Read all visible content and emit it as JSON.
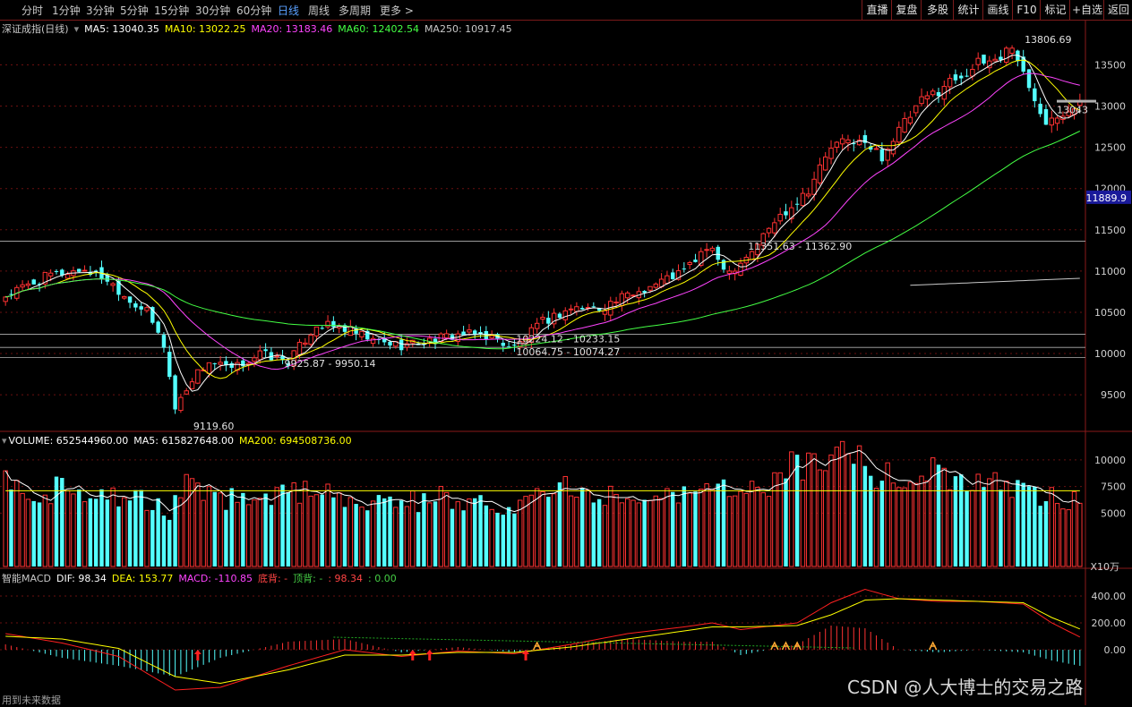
{
  "toolbar": {
    "periods": [
      "分时",
      "1分钟",
      "3分钟",
      "5分钟",
      "15分钟",
      "30分钟",
      "60分钟",
      "日线",
      "周线",
      "多周期",
      "更多 >"
    ],
    "active_period": "日线",
    "right_buttons": [
      "直播",
      "复盘",
      "多股",
      "统计",
      "画线",
      "F10",
      "标记",
      "+自选",
      "返回"
    ]
  },
  "price_panel": {
    "title": "深证成指(日线)",
    "ma_labels": [
      {
        "text": "MA5: 13040.35",
        "color": "#ffffff"
      },
      {
        "text": "MA10: 13022.25",
        "color": "#ffff00"
      },
      {
        "text": "MA20: 13183.46",
        "color": "#ff44ff"
      },
      {
        "text": "MA60: 12402.54",
        "color": "#44ff44"
      },
      {
        "text": "MA250: 10917.45",
        "color": "#c8c8c8"
      }
    ],
    "current_price_label": "11889.9",
    "right_edge_label": "13043",
    "annotations": [
      "13806.69",
      "9119.60",
      "9925.87 - 9950.14",
      "10224.12 - 10233.15",
      "10064.75 - 10074.27",
      "11351.63 - 11362.90"
    ]
  },
  "volume_panel": {
    "legend": [
      {
        "text": "VOLUME: 652544960.00",
        "color": "#ffffff"
      },
      {
        "text": "MA5: 615827648.00",
        "color": "#ffffff"
      },
      {
        "text": "MA200: 694508736.00",
        "color": "#ffff00"
      }
    ],
    "unit": "X10万"
  },
  "macd_panel": {
    "legend": [
      {
        "text": "智能MACD",
        "color": "#c8c8c8"
      },
      {
        "text": "DIF: 98.34",
        "color": "#ffffff"
      },
      {
        "text": "DEA: 153.77",
        "color": "#ffff00"
      },
      {
        "text": "MACD: -110.85",
        "color": "#ff44ff"
      },
      {
        "text": "底背: -",
        "color": "#ff4444"
      },
      {
        "text": "顶背: -",
        "color": "#44cc44"
      },
      {
        "text": ": 98.34",
        "color": "#ff4444"
      },
      {
        "text": ": 0.00",
        "color": "#44cc44"
      }
    ]
  },
  "bottom_note": "用到未来数据",
  "watermark": "CSDN @人大博士的交易之路",
  "chart_data": [
    {
      "type": "candlestick",
      "panel": "price",
      "ylim": [
        9100,
        13950
      ],
      "y_ticks": [
        9500,
        10000,
        10500,
        11000,
        11500,
        12000,
        12500,
        13000,
        13500
      ],
      "grid": "horizontal dashed",
      "horizontal_levels": [
        11362.9,
        10233.15,
        10074.27,
        9950.14
      ],
      "anchors_close": [
        [
          0,
          10700
        ],
        [
          8,
          10950
        ],
        [
          14,
          11020
        ],
        [
          18,
          10900
        ],
        [
          22,
          10650
        ],
        [
          25,
          10500
        ],
        [
          28,
          10100
        ],
        [
          30,
          9330
        ],
        [
          33,
          9700
        ],
        [
          36,
          9900
        ],
        [
          40,
          9800
        ],
        [
          45,
          10000
        ],
        [
          50,
          9900
        ],
        [
          55,
          10350
        ],
        [
          60,
          10300
        ],
        [
          65,
          10150
        ],
        [
          70,
          10100
        ],
        [
          75,
          10150
        ],
        [
          80,
          10230
        ],
        [
          85,
          10220
        ],
        [
          90,
          10070
        ],
        [
          95,
          10380
        ],
        [
          100,
          10550
        ],
        [
          105,
          10550
        ],
        [
          110,
          10700
        ],
        [
          115,
          10850
        ],
        [
          120,
          11000
        ],
        [
          124,
          11280
        ],
        [
          128,
          11000
        ],
        [
          132,
          11250
        ],
        [
          136,
          11600
        ],
        [
          142,
          12000
        ],
        [
          146,
          12500
        ],
        [
          150,
          12600
        ],
        [
          155,
          12400
        ],
        [
          158,
          12700
        ],
        [
          162,
          13050
        ],
        [
          167,
          13300
        ],
        [
          172,
          13500
        ],
        [
          176,
          13600
        ],
        [
          178,
          13750
        ],
        [
          181,
          13200
        ],
        [
          184,
          12850
        ],
        [
          187,
          12950
        ],
        [
          190,
          13040
        ]
      ],
      "ma_series": [
        "MA5",
        "MA10",
        "MA20",
        "MA60",
        "MA250"
      ]
    },
    {
      "type": "bar",
      "panel": "volume",
      "unit": "X10万",
      "ylim": [
        0,
        11500
      ],
      "y_ticks": [
        5000,
        7500,
        10000
      ],
      "ma200_level": 7100,
      "anchors": [
        [
          0,
          8200
        ],
        [
          6,
          7000
        ],
        [
          12,
          7400
        ],
        [
          18,
          6800
        ],
        [
          24,
          6100
        ],
        [
          29,
          5000
        ],
        [
          32,
          8600
        ],
        [
          36,
          6400
        ],
        [
          42,
          6500
        ],
        [
          50,
          6800
        ],
        [
          56,
          7000
        ],
        [
          62,
          6200
        ],
        [
          70,
          6100
        ],
        [
          80,
          6500
        ],
        [
          90,
          5600
        ],
        [
          95,
          7100
        ],
        [
          100,
          7200
        ],
        [
          110,
          6600
        ],
        [
          115,
          7400
        ],
        [
          120,
          7000
        ],
        [
          126,
          6900
        ],
        [
          132,
          7100
        ],
        [
          136,
          8000
        ],
        [
          140,
          9700
        ],
        [
          144,
          10200
        ],
        [
          148,
          11200
        ],
        [
          152,
          9500
        ],
        [
          156,
          8300
        ],
        [
          160,
          7800
        ],
        [
          165,
          9000
        ],
        [
          170,
          8200
        ],
        [
          176,
          7400
        ],
        [
          180,
          7400
        ],
        [
          186,
          6300
        ],
        [
          190,
          6500
        ]
      ]
    },
    {
      "type": "line",
      "panel": "macd",
      "series": [
        "DIF",
        "DEA",
        "MACD"
      ],
      "ylim": [
        -380,
        520
      ],
      "y_ticks": [
        0,
        200,
        400
      ],
      "dif_anchors": [
        [
          0,
          120
        ],
        [
          10,
          50
        ],
        [
          20,
          -50
        ],
        [
          30,
          -300
        ],
        [
          38,
          -280
        ],
        [
          50,
          -120
        ],
        [
          60,
          0
        ],
        [
          70,
          -50
        ],
        [
          80,
          -10
        ],
        [
          90,
          -30
        ],
        [
          100,
          40
        ],
        [
          110,
          120
        ],
        [
          120,
          170
        ],
        [
          125,
          200
        ],
        [
          130,
          150
        ],
        [
          140,
          200
        ],
        [
          146,
          350
        ],
        [
          152,
          450
        ],
        [
          158,
          380
        ],
        [
          165,
          360
        ],
        [
          172,
          360
        ],
        [
          180,
          340
        ],
        [
          185,
          200
        ],
        [
          190,
          95
        ]
      ],
      "dea_anchors": [
        [
          0,
          100
        ],
        [
          10,
          80
        ],
        [
          20,
          10
        ],
        [
          30,
          -200
        ],
        [
          38,
          -250
        ],
        [
          50,
          -150
        ],
        [
          60,
          -40
        ],
        [
          70,
          -40
        ],
        [
          80,
          -20
        ],
        [
          90,
          -20
        ],
        [
          100,
          20
        ],
        [
          110,
          80
        ],
        [
          120,
          140
        ],
        [
          125,
          170
        ],
        [
          130,
          170
        ],
        [
          140,
          180
        ],
        [
          146,
          260
        ],
        [
          152,
          370
        ],
        [
          158,
          380
        ],
        [
          165,
          370
        ],
        [
          172,
          360
        ],
        [
          180,
          350
        ],
        [
          185,
          240
        ],
        [
          190,
          155
        ]
      ]
    }
  ]
}
